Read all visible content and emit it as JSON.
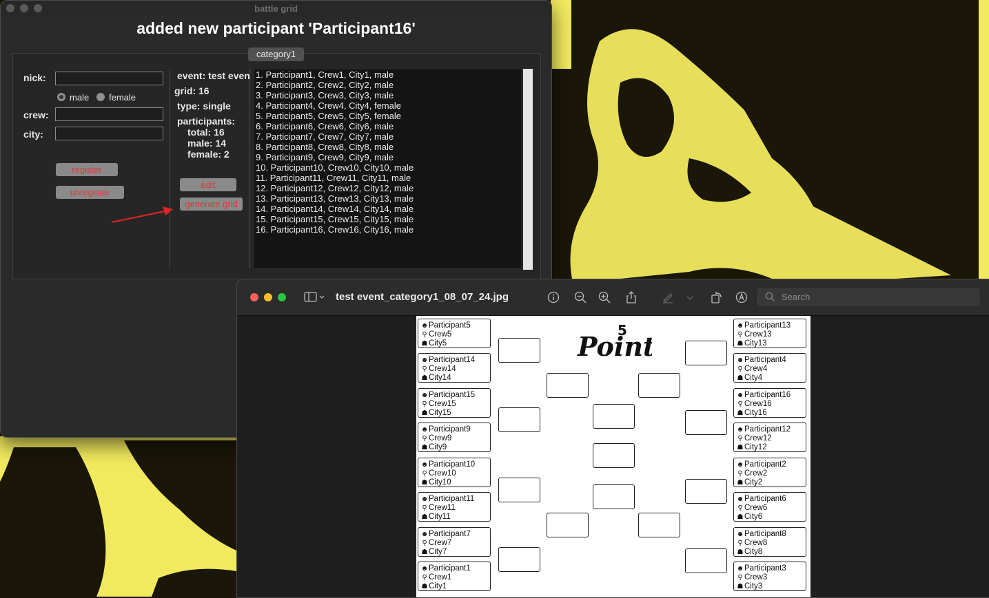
{
  "colors": {
    "wallpaper_yellow": "#f2ea5e",
    "wallpaper_dark": "#1a1608",
    "button_text_red": "#d63a3a",
    "annotation_arrow": "#e02424"
  },
  "battle_window": {
    "title": "battle grid",
    "headline": "added new participant 'Participant16'",
    "tab": "category1",
    "form": {
      "nick_label": "nick:",
      "nick_value": "",
      "gender_options": [
        {
          "label": "male",
          "selected": true
        },
        {
          "label": "female",
          "selected": false
        }
      ],
      "crew_label": "crew:",
      "crew_value": "",
      "city_label": "city:",
      "city_value": "",
      "register_button": "register",
      "unregister_button": "unregister"
    },
    "info": {
      "event": "event: test event",
      "grid": "grid: 16",
      "type": "type: single",
      "participants_label": "participants:",
      "total": "total: 16",
      "male": "male: 14",
      "female": "female: 2",
      "edit_button": "edit",
      "generate_button": "generate grid"
    },
    "participants": [
      "1. Participant1, Crew1, City1, male",
      "2. Participant2, Crew2, City2, male",
      "3. Participant3, Crew3, City3, male",
      "4. Participant4, Crew4, City4, female",
      "5. Participant5, Crew5, City5, female",
      "6. Participant6, Crew6, City6, male",
      "7. Participant7, Crew7, City7, male",
      "8. Participant8, Crew8, City8, male",
      "9. Participant9, Crew9, City9, male",
      "10. Participant10, Crew10, City10, male",
      "11. Participant11, Crew11, City11, male",
      "12. Participant12, Crew12, City12, male",
      "13. Participant13, Crew13, City13, male",
      "14. Participant14, Crew14, City14, male",
      "15. Participant15, Crew15, City15, male",
      "16. Participant16, Crew16, City16, male"
    ]
  },
  "preview_window": {
    "filename": "test event_category1_08_07_24.jpg",
    "search_placeholder": "Search",
    "toolbar_icons": [
      "sidebar-icon",
      "info-icon",
      "zoom-out-icon",
      "zoom-in-icon",
      "share-icon",
      "markup-pen-icon",
      "rotate-icon",
      "annotate-icon"
    ],
    "logo_text": "Points",
    "logo_digit": "5",
    "left_cards": [
      {
        "name": "Participant5",
        "crew": "Crew5",
        "city": "City5",
        "gender": "female"
      },
      {
        "name": "Participant14",
        "crew": "Crew14",
        "city": "City14",
        "gender": "male"
      },
      {
        "name": "Participant15",
        "crew": "Crew15",
        "city": "City15",
        "gender": "male"
      },
      {
        "name": "Participant9",
        "crew": "Crew9",
        "city": "City9",
        "gender": "male"
      },
      {
        "name": "Participant10",
        "crew": "Crew10",
        "city": "City10",
        "gender": "male"
      },
      {
        "name": "Participant11",
        "crew": "Crew11",
        "city": "City11",
        "gender": "male"
      },
      {
        "name": "Participant7",
        "crew": "Crew7",
        "city": "City7",
        "gender": "male"
      },
      {
        "name": "Participant1",
        "crew": "Crew1",
        "city": "City1",
        "gender": "male"
      }
    ],
    "right_cards": [
      {
        "name": "Participant13",
        "crew": "Crew13",
        "city": "City13",
        "gender": "male"
      },
      {
        "name": "Participant4",
        "crew": "Crew4",
        "city": "City4",
        "gender": "female"
      },
      {
        "name": "Participant16",
        "crew": "Crew16",
        "city": "City16",
        "gender": "male"
      },
      {
        "name": "Participant12",
        "crew": "Crew12",
        "city": "City12",
        "gender": "male"
      },
      {
        "name": "Participant2",
        "crew": "Crew2",
        "city": "City2",
        "gender": "male"
      },
      {
        "name": "Participant6",
        "crew": "Crew6",
        "city": "City6",
        "gender": "male"
      },
      {
        "name": "Participant8",
        "crew": "Crew8",
        "city": "City8",
        "gender": "male"
      },
      {
        "name": "Participant3",
        "crew": "Crew3",
        "city": "City3",
        "gender": "male"
      }
    ]
  }
}
